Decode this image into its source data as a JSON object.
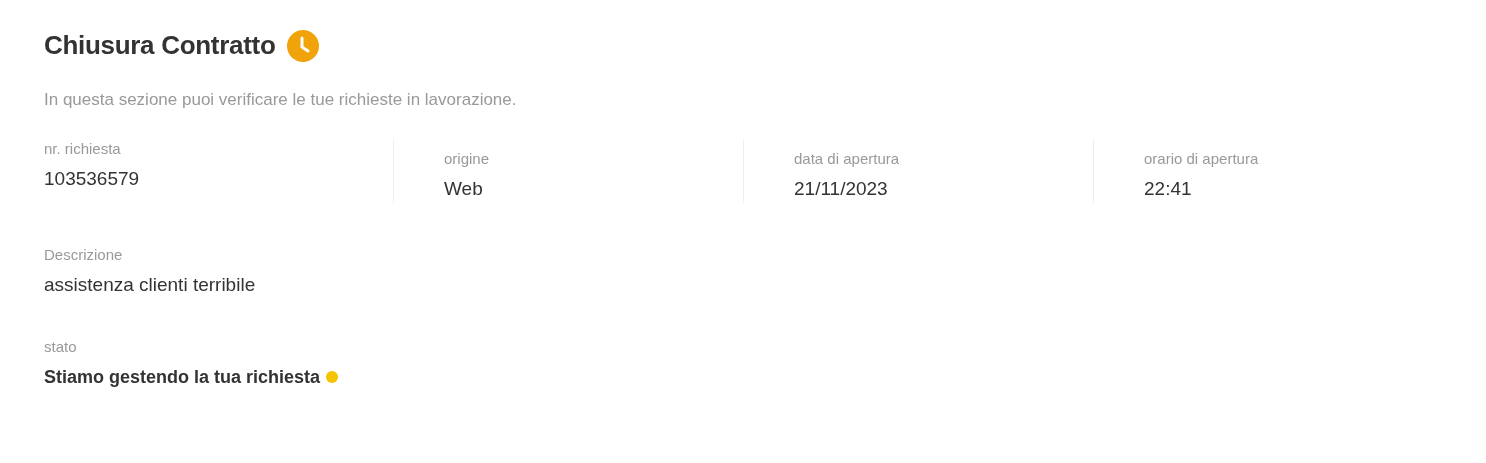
{
  "title": "Chiusura Contratto",
  "subtitle": "In questa sezione puoi verificare le tue richieste in lavorazione.",
  "fields": [
    {
      "label": "nr. richiesta",
      "value": "103536579"
    },
    {
      "label": "origine",
      "value": "Web"
    },
    {
      "label": "data di apertura",
      "value": "21/11/2023"
    },
    {
      "label": "orario di apertura",
      "value": "22:41"
    }
  ],
  "description": {
    "label": "Descrizione",
    "value": "assistenza clienti terribile"
  },
  "status": {
    "label": "stato",
    "value": "Stiamo gestendo la tua richiesta",
    "color": "#f5c400"
  }
}
